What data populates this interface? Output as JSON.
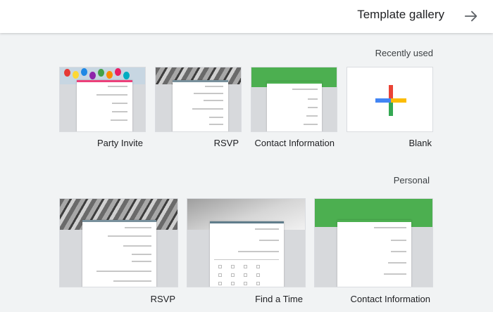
{
  "header": {
    "title": "Template gallery",
    "back_icon": "arrow-back-icon"
  },
  "sections": {
    "recent": {
      "title": "Recently used",
      "cards": [
        {
          "label": "Blank"
        },
        {
          "label": "Contact Information"
        },
        {
          "label": "RSVP"
        },
        {
          "label": "Party Invite"
        }
      ]
    },
    "personal": {
      "title": "Personal",
      "cards": [
        {
          "label": "Contact Information"
        },
        {
          "label": "Find a Time"
        },
        {
          "label": "RSVP"
        }
      ]
    }
  },
  "colors": {
    "header_bg": "#ffffff",
    "page_bg": "#f1f3f4",
    "forms_green": "#4caf50",
    "plus_red": "#ea4335",
    "plus_blue": "#4285f4",
    "plus_green": "#34a853",
    "plus_yellow": "#fbbc04"
  }
}
